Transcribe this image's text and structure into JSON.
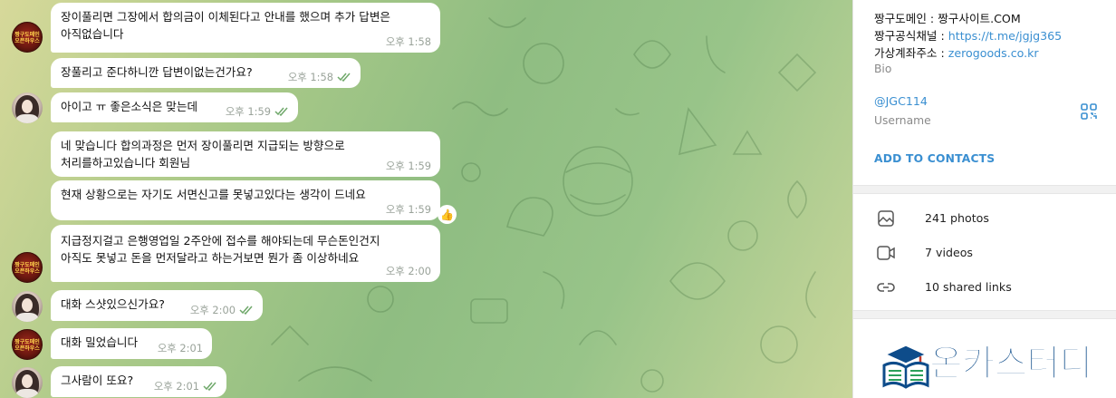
{
  "chat": {
    "messages": [
      {
        "sender": "brand",
        "text": "장이풀리면 그장에서 합의금이 이체된다고 안내를 했으며 추가 답변은\n아직없습니다",
        "time": "오후 1:58",
        "read": false
      },
      {
        "sender": "user",
        "text": "장풀리고 준다하니깐 답변이없는건가요?",
        "time": "오후 1:58",
        "read": true
      },
      {
        "sender": "user",
        "text": "아이고 ㅠ 좋은소식은 맞는데",
        "time": "오후 1:59",
        "read": true
      },
      {
        "sender": "brand",
        "text": "네 맞습니다 합의과정은 먼저 장이풀리면 지급되는 방향으로\n처리를하고있습니다 회원님",
        "time": "오후 1:59",
        "read": false
      },
      {
        "sender": "brand",
        "text": "현재 상황으로는 자기도 서면신고를 못넣고있다는 생각이 드네요",
        "time": "오후 1:59",
        "read": false,
        "reaction": "👍"
      },
      {
        "sender": "brand",
        "text": "지급정지걸고 은행영업일 2주안에 접수를 해야되는데 무슨돈인건지\n아직도 못넣고 돈을 먼저달라고 하는거보면 뭔가 좀 이상하네요",
        "time": "오후 2:00",
        "read": false
      },
      {
        "sender": "user",
        "text": "대화 스샷있으신가요?",
        "time": "오후 2:00",
        "read": true
      },
      {
        "sender": "brand",
        "text": "대화 밀었습니다",
        "time": "오후 2:01",
        "read": false
      },
      {
        "sender": "user",
        "text": "그사람이 또요?",
        "time": "오후 2:01",
        "read": true
      }
    ],
    "brand_avatar_text": [
      "짱구도메인",
      "오픈하우스"
    ]
  },
  "panel": {
    "bio_lines": [
      {
        "label": "짱구도메인 : ",
        "value": "짱구사이트.COM",
        "is_link": false
      },
      {
        "label": "짱구공식채널 : ",
        "value": "https://t.me/jgjg365",
        "is_link": true
      },
      {
        "label": "가상계좌주소 : ",
        "value": "zerogoods.co.kr",
        "is_link": true
      }
    ],
    "bio_caption": "Bio",
    "username": "@JGC114",
    "username_caption": "Username",
    "add_contacts": "ADD TO CONTACTS",
    "media": [
      {
        "icon": "photo-icon",
        "label": "241 photos"
      },
      {
        "icon": "video-icon",
        "label": "7 videos"
      },
      {
        "icon": "link-icon",
        "label": "10 shared links"
      }
    ]
  },
  "watermark": {
    "text": "온카스터디"
  },
  "colors": {
    "link": "#3a8fd1",
    "tick": "#6fa86a",
    "bubble": "#ffffff",
    "watermark": "#0e4c8a"
  }
}
